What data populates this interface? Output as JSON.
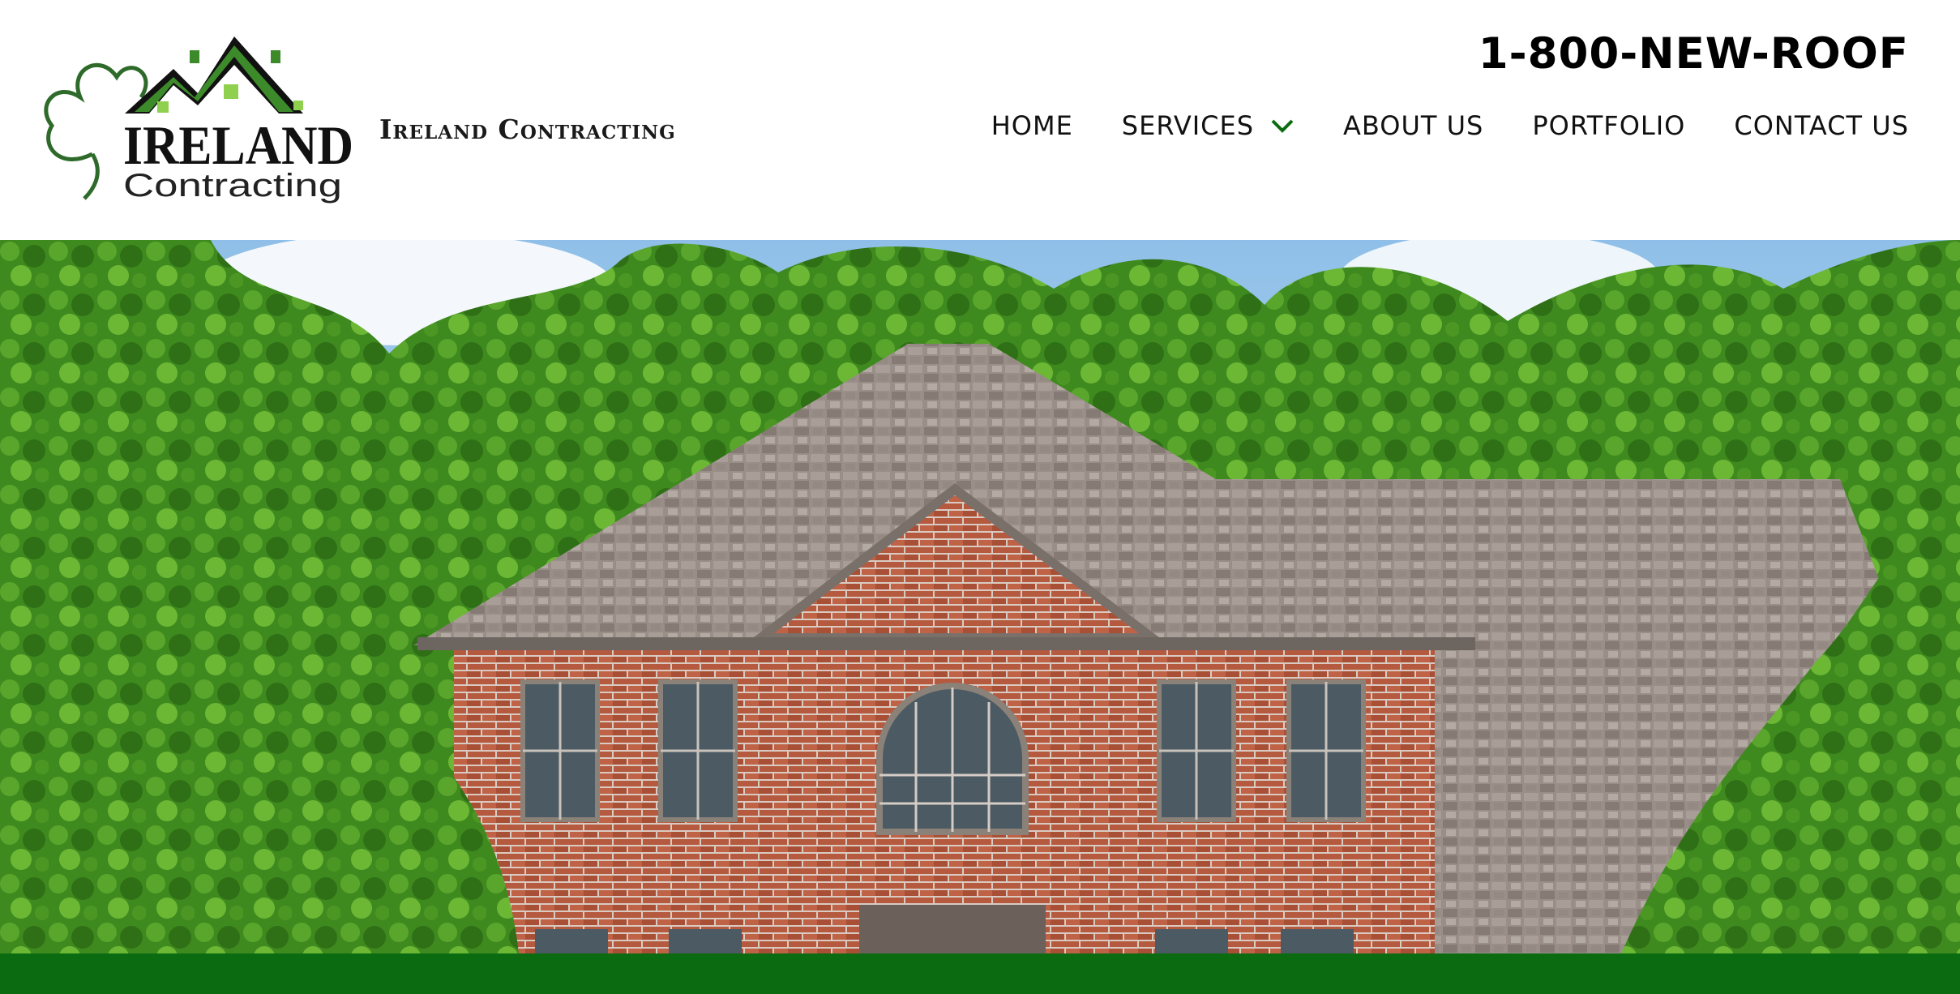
{
  "header": {
    "logo_alt": "Ireland Contracting logo",
    "logo_text_top": "IRELAND",
    "logo_text_bottom": "Contracting",
    "brand_name": "Ireland Contracting",
    "phone": "1-800-NEW-ROOF"
  },
  "nav": {
    "items": [
      {
        "label": "HOME"
      },
      {
        "label": "SERVICES",
        "icon": "chevron-down-icon"
      },
      {
        "label": "ABOUT US"
      },
      {
        "label": "PORTFOLIO"
      },
      {
        "label": "CONTACT US"
      }
    ]
  },
  "colors": {
    "brand_green": "#0b6b10",
    "logo_green": "#2e7d1f",
    "text": "#111111"
  },
  "hero": {
    "description_icon": "house-photo"
  }
}
